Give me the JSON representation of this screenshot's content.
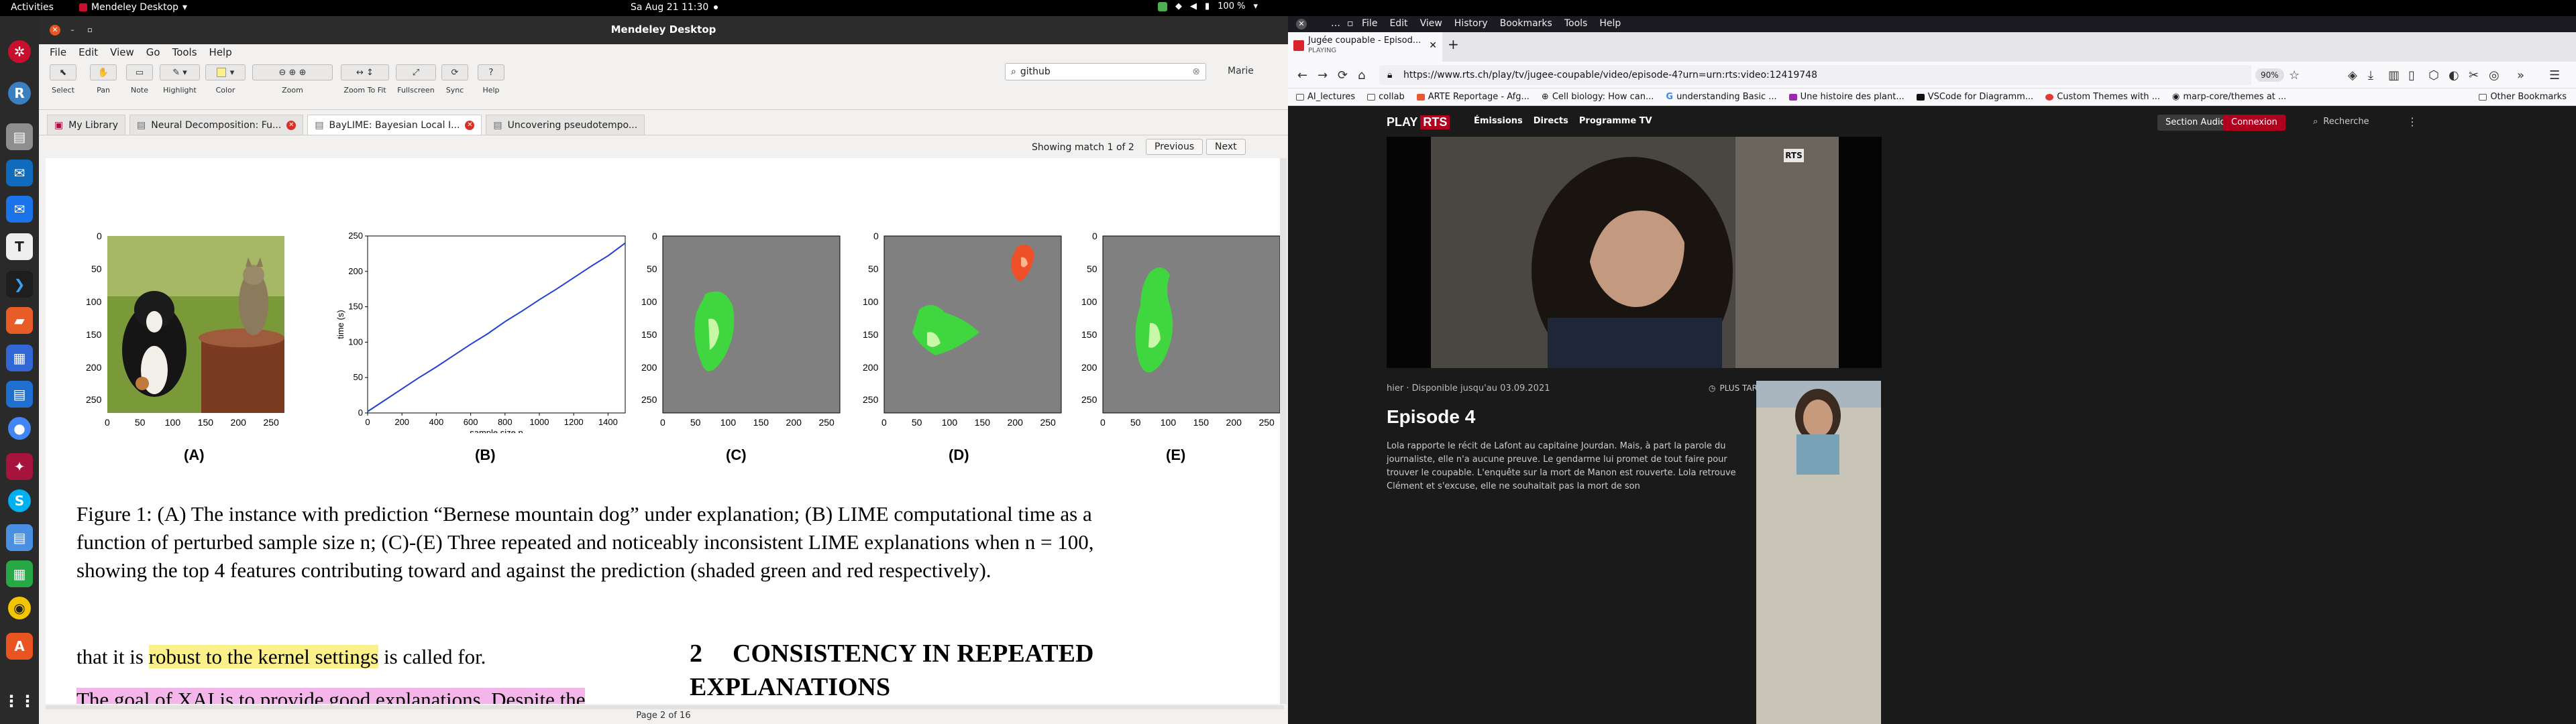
{
  "topbar": {
    "activities": "Activities",
    "app": "Mendeley Desktop",
    "date": "Sa Aug 21  11:30",
    "battery": "100 %"
  },
  "mendeley": {
    "window_title": "Mendeley Desktop",
    "menu": [
      "File",
      "Edit",
      "View",
      "Go",
      "Tools",
      "Help"
    ],
    "tools": [
      {
        "label": "Select",
        "icon": "cursor-icon"
      },
      {
        "label": "Pan",
        "icon": "hand-icon"
      },
      {
        "label": "Note",
        "icon": "note-icon"
      },
      {
        "label": "Highlight",
        "icon": "highlighter-icon"
      },
      {
        "label": "Color",
        "icon": "color-icon"
      },
      {
        "label": "Zoom",
        "icon": "zoom-icon"
      },
      {
        "label": "Zoom To Fit",
        "icon": "fit-icon"
      },
      {
        "label": "Fullscreen",
        "icon": "fullscreen-icon"
      },
      {
        "label": "Sync",
        "icon": "sync-icon"
      },
      {
        "label": "Help",
        "icon": "help-icon"
      }
    ],
    "search_value": "github",
    "user": "Marie",
    "tabs": [
      {
        "label": "My Library"
      },
      {
        "label": "Neural Decomposition: Fu..."
      },
      {
        "label": "BayLIME: Bayesian Local I..."
      },
      {
        "label": "Uncovering pseudotempo..."
      }
    ],
    "match_text": "Showing match 1 of 2",
    "prev_label": "Previous",
    "next_label": "Next",
    "page_status": "Page 2 of 16"
  },
  "document": {
    "figure_labels": [
      "(A)",
      "(B)",
      "(C)",
      "(D)",
      "(E)"
    ],
    "image_yticks": [
      "0",
      "50",
      "100",
      "150",
      "200",
      "250"
    ],
    "image_xticks": [
      "0",
      "50",
      "100",
      "150",
      "200",
      "250"
    ],
    "chart_b_xlabel": "sample size n",
    "chart_b_ylabel": "time (s)",
    "caption": [
      "Figure 1: (A) The instance with prediction “Bernese mountain dog” under explanation; (B) LIME computational time as a",
      "function of perturbed sample size n; (C)-(E) Three repeated and noticeably inconsistent LIME explanations when n = 100,",
      "showing the top 4 features contributing toward and against the prediction (shaded green and red respectively)."
    ],
    "body_line1_pre": "that it is ",
    "body_line1_hl": "robust to the kernel settings",
    "body_line1_post": " is called for.",
    "body_line2": "The goal of XAI is to provide good explanations. Despite the",
    "section_num": "2",
    "section_title": "CONSISTENCY IN REPEATED EXPLANATIONS"
  },
  "chart_data": {
    "type": "line",
    "title": "",
    "xlabel": "sample size n",
    "ylabel": "time (s)",
    "xlim": [
      0,
      1500
    ],
    "ylim": [
      0,
      250
    ],
    "xticks": [
      0,
      200,
      400,
      600,
      800,
      1000,
      1200,
      1400
    ],
    "yticks": [
      0,
      50,
      100,
      150,
      200,
      250
    ],
    "x": [
      0,
      100,
      200,
      300,
      400,
      500,
      600,
      700,
      800,
      900,
      1000,
      1100,
      1200,
      1300,
      1400,
      1500
    ],
    "series": [
      {
        "values": [
          2,
          18,
          34,
          50,
          65,
          81,
          97,
          112,
          129,
          144,
          160,
          175,
          191,
          207,
          222,
          240
        ],
        "color": "#1f3fd6"
      }
    ],
    "grid": false
  },
  "firefox": {
    "menu": [
      "File",
      "Edit",
      "View",
      "History",
      "Bookmarks",
      "Tools",
      "Help"
    ],
    "tab_title": "Jugée coupable - Episod...",
    "tab_sub": "PLAYING",
    "url": "https://www.rts.ch/play/tv/jugee-coupable/video/episode-4?urn=urn:rts:video:12419748",
    "zoom": "90%",
    "bookmarks": [
      "AI_lectures",
      "collab",
      "ARTE Reportage - Afg...",
      "Cell biology: How can...",
      "understanding Basic ...",
      "Une histoire des plant...",
      "VSCode for Diagramm...",
      "Custom Themes with ...",
      "marp-core/themes at ..."
    ],
    "other_bookmarks": "Other Bookmarks"
  },
  "rts": {
    "logo_play": "PLAY",
    "logo_rts": "RTS",
    "nav": [
      "Émissions",
      "Directs",
      "Programme TV"
    ],
    "section_audio": "Section Audio",
    "connexion": "Connexion",
    "search": "Recherche",
    "badge": "RTS",
    "meta": "hier · Disponible jusqu'au 03.09.2021",
    "plus_tard": "PLUS TARD",
    "episode_title": "Episode 4",
    "description": "Lola rapporte le récit de Lafont au capitaine Jourdan. Mais, à part la parole du journaliste, elle n'a aucune preuve. Le gendarme lui promet de tout faire pour trouver le coupable. L'enquête sur la mort de Manon est rouverte. Lola retrouve Clément et s'excuse, elle ne souhaitait pas la mort de son"
  },
  "colors": {
    "highlight_yellow": "#fcf08b",
    "highlight_pink": "#f4b6ea",
    "rts_red": "#af001e",
    "tab_close_red": "#d93025"
  }
}
